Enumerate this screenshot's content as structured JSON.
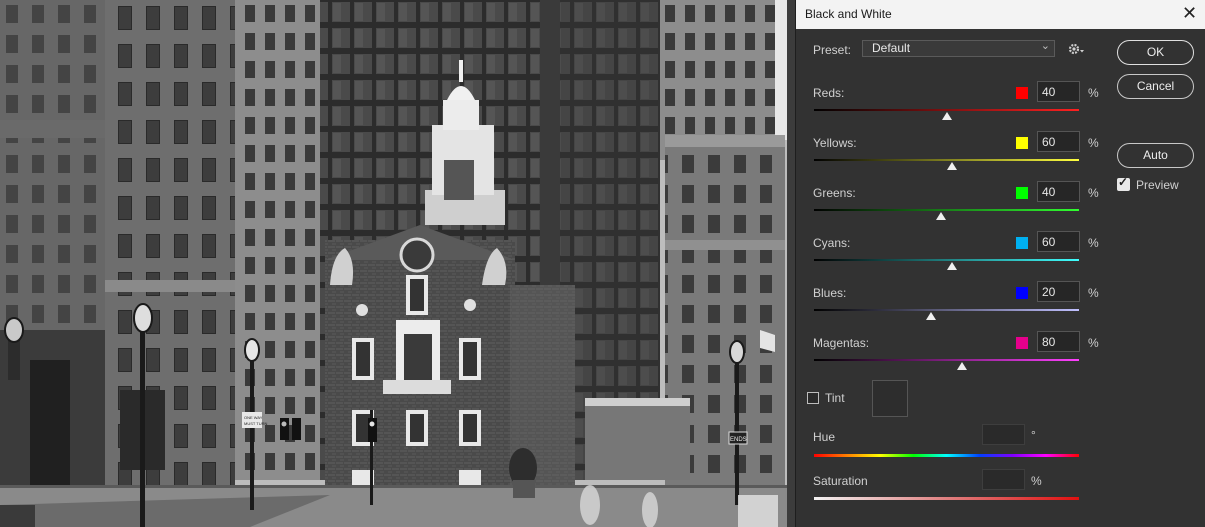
{
  "dialog": {
    "title": "Black and White",
    "close_icon": "close-icon"
  },
  "preset": {
    "label": "Preset:",
    "value": "Default",
    "options_icon": "gear-icon"
  },
  "buttons": {
    "ok": "OK",
    "cancel": "Cancel",
    "auto": "Auto"
  },
  "preview": {
    "label": "Preview",
    "checked": true
  },
  "channels": [
    {
      "label": "Reds:",
      "value": "40",
      "unit": "%",
      "color": "#ff0000",
      "gradient_from": "#000000",
      "gradient_to": "#ff2020",
      "level": 0.5
    },
    {
      "label": "Yellows:",
      "value": "60",
      "unit": "%",
      "color": "#ffff00",
      "gradient_from": "#000000",
      "gradient_to": "#ffff40",
      "level": 0.52
    },
    {
      "label": "Greens:",
      "value": "40",
      "unit": "%",
      "color": "#00ff00",
      "gradient_from": "#000000",
      "gradient_to": "#30ff30",
      "level": 0.48
    },
    {
      "label": "Cyans:",
      "value": "60",
      "unit": "%",
      "color": "#00b0f0",
      "gradient_from": "#000000",
      "gradient_to": "#40ffff",
      "level": 0.52
    },
    {
      "label": "Blues:",
      "value": "20",
      "unit": "%",
      "color": "#0000ff",
      "gradient_from": "#000000",
      "gradient_to": "#c0c0ff",
      "level": 0.44
    },
    {
      "label": "Magentas:",
      "value": "80",
      "unit": "%",
      "color": "#e6008c",
      "gradient_from": "#000000",
      "gradient_to": "#ff40ff",
      "level": 0.56
    }
  ],
  "tint": {
    "label": "Tint",
    "checked": false
  },
  "hue": {
    "label": "Hue",
    "value": "",
    "unit": "°"
  },
  "saturation": {
    "label": "Saturation",
    "value": "",
    "unit": "%"
  },
  "photo": {
    "description_icon": "image-canvas",
    "sign_one_way": "ONE WAY",
    "sign_must_turn": "MUST TURN",
    "sign_ends": "ENDS"
  }
}
